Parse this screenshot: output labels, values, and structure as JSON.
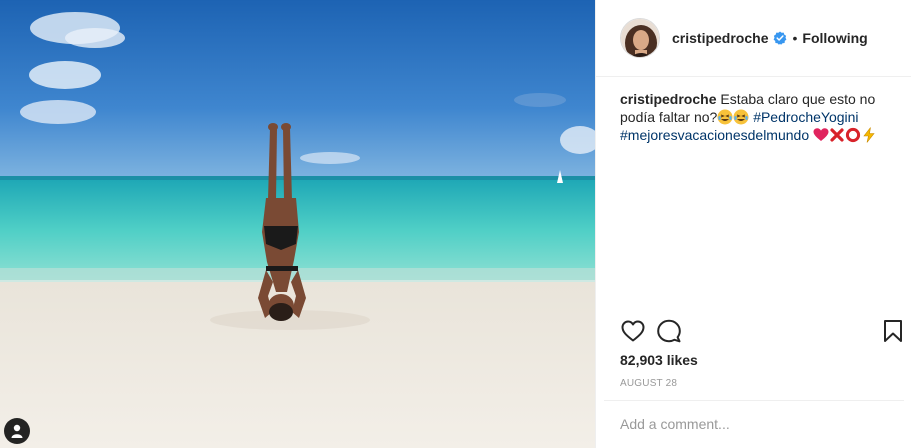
{
  "post": {
    "username": "cristipedroche",
    "separator": "•",
    "follow_label": "Following",
    "caption": {
      "username": "cristipedroche",
      "text_1": "Estaba claro que esto no podía faltar no?",
      "hashtag_1": "#PedrocheYogini",
      "hashtag_2": "#mejoresvacacionesdelmundo"
    },
    "likes_label": "82,903 likes",
    "date_label": "AUGUST 28",
    "comment": {
      "placeholder": "Add a comment..."
    }
  },
  "icons": {
    "verified": "verified-badge-icon",
    "like": "heart-outline-icon",
    "comment": "speech-bubble-icon",
    "save": "bookmark-icon",
    "tagged": "tagged-user-icon"
  },
  "colors": {
    "text": "#262626",
    "hashtag": "#003569",
    "muted": "#999999",
    "verified": "#3897f0",
    "divider": "#efefef"
  }
}
